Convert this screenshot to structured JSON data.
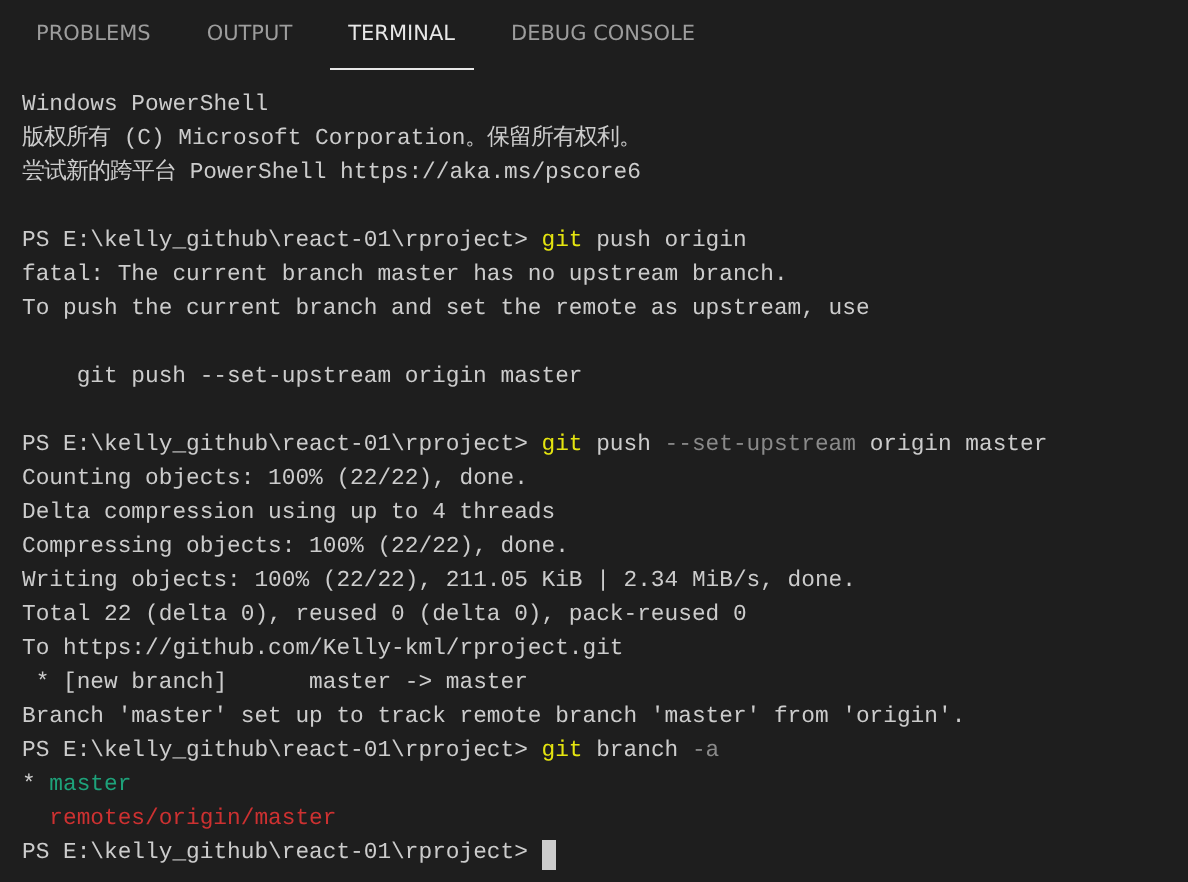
{
  "tabs": [
    {
      "label": "PROBLEMS",
      "selected": false
    },
    {
      "label": "OUTPUT",
      "selected": false
    },
    {
      "label": "TERMINAL",
      "selected": true
    },
    {
      "label": "DEBUG CONSOLE",
      "selected": false
    }
  ],
  "terminal": {
    "lines": [
      {
        "kind": "output",
        "segments": [
          {
            "kind": "text",
            "text": "Windows PowerShell"
          }
        ]
      },
      {
        "kind": "output",
        "segments": [
          {
            "kind": "text",
            "text": "版权所有 (C) Microsoft Corporation。保留所有权利。"
          }
        ]
      },
      {
        "kind": "output",
        "segments": [
          {
            "kind": "text",
            "text": "尝试新的跨平台 PowerShell https://aka.ms/pscore6"
          }
        ]
      },
      {
        "kind": "blank"
      },
      {
        "kind": "output",
        "segments": [
          {
            "kind": "prompt",
            "text": "PS E:\\kelly_github\\react-01\\rproject> "
          },
          {
            "kind": "command",
            "text": "git"
          },
          {
            "kind": "text",
            "text": " push origin"
          }
        ]
      },
      {
        "kind": "output",
        "segments": [
          {
            "kind": "text",
            "text": "fatal: The current branch master has no upstream branch."
          }
        ]
      },
      {
        "kind": "output",
        "segments": [
          {
            "kind": "text",
            "text": "To push the current branch and set the remote as upstream, use"
          }
        ]
      },
      {
        "kind": "blank"
      },
      {
        "kind": "output",
        "segments": [
          {
            "kind": "indent"
          },
          {
            "kind": "text",
            "text": "git push --set-upstream origin master"
          }
        ]
      },
      {
        "kind": "blank"
      },
      {
        "kind": "output",
        "segments": [
          {
            "kind": "prompt",
            "text": "PS E:\\kelly_github\\react-01\\rproject> "
          },
          {
            "kind": "command",
            "text": "git"
          },
          {
            "kind": "text",
            "text": " push "
          },
          {
            "kind": "param",
            "text": "--set-upstream"
          },
          {
            "kind": "text",
            "text": " origin master"
          }
        ]
      },
      {
        "kind": "output",
        "segments": [
          {
            "kind": "text",
            "text": "Counting objects: 100% (22/22), done."
          }
        ]
      },
      {
        "kind": "output",
        "segments": [
          {
            "kind": "text",
            "text": "Delta compression using up to 4 threads"
          }
        ]
      },
      {
        "kind": "output",
        "segments": [
          {
            "kind": "text",
            "text": "Compressing objects: 100% (22/22), done."
          }
        ]
      },
      {
        "kind": "output",
        "segments": [
          {
            "kind": "text",
            "text": "Writing objects: 100% (22/22), 211.05 KiB | 2.34 MiB/s, done."
          }
        ]
      },
      {
        "kind": "output",
        "segments": [
          {
            "kind": "text",
            "text": "Total 22 (delta 0), reused 0 (delta 0), pack-reused 0"
          }
        ]
      },
      {
        "kind": "output",
        "segments": [
          {
            "kind": "text",
            "text": "To https://github.com/Kelly-kml/rproject.git"
          }
        ]
      },
      {
        "kind": "output",
        "segments": [
          {
            "kind": "text",
            "text": " * [new branch]      master -> master"
          }
        ]
      },
      {
        "kind": "output",
        "segments": [
          {
            "kind": "text",
            "text": "Branch 'master' set up to track remote branch 'master' from 'origin'."
          }
        ]
      },
      {
        "kind": "output",
        "segments": [
          {
            "kind": "prompt",
            "text": "PS E:\\kelly_github\\react-01\\rproject> "
          },
          {
            "kind": "command",
            "text": "git"
          },
          {
            "kind": "text",
            "text": " branch "
          },
          {
            "kind": "param",
            "text": "-a"
          }
        ]
      },
      {
        "kind": "output",
        "segments": [
          {
            "kind": "text",
            "text": "* "
          },
          {
            "kind": "current-branch",
            "text": "master"
          }
        ]
      },
      {
        "kind": "output",
        "segments": [
          {
            "kind": "indent"
          },
          {
            "kind": "remote-branch",
            "text": "remotes/origin/master"
          }
        ]
      },
      {
        "kind": "output",
        "segments": [
          {
            "kind": "prompt",
            "text": "PS E:\\kelly_github\\react-01\\rproject> "
          },
          {
            "kind": "cursor"
          }
        ]
      }
    ]
  }
}
